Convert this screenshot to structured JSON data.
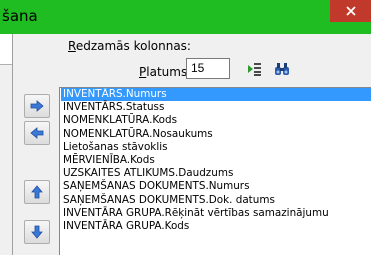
{
  "window": {
    "title": "šana"
  },
  "settings": {
    "visible_columns_label_prefix": "R",
    "visible_columns_label_rest": "edzamās kolonnas:",
    "width_label_prefix": "P",
    "width_label_rest": "latums:",
    "width_value": "15"
  },
  "icons": {
    "apply_width": "column-width-icon",
    "find": "binoculars-icon",
    "add": "arrow-right-icon",
    "remove": "arrow-left-icon",
    "move_up": "arrow-up-icon",
    "move_down": "arrow-down-icon",
    "close": "close-icon"
  },
  "colors": {
    "titlebar": "#1fbc22",
    "close": "#c0392b",
    "selection": "#3399ff"
  },
  "columns": [
    "INVENTĀRS.Numurs",
    "INVENTĀRS.Statuss",
    "NOMENKLATŪRA.Kods",
    "NOMENKLATŪRA.Nosaukums",
    "Lietošanas stāvoklis",
    "MĒRVIENĪBA.Kods",
    "UZSKAITES ATLIKUMS.Daudzums",
    "SAŅEMŠANAS DOKUMENTS.Numurs",
    "SAŅEMŠANAS DOKUMENTS.Dok. datums",
    "INVENTĀRA GRUPA.Rēķināt vērtības samazinājumu",
    "INVENTĀRA GRUPA.Kods"
  ],
  "selected_index": 0
}
